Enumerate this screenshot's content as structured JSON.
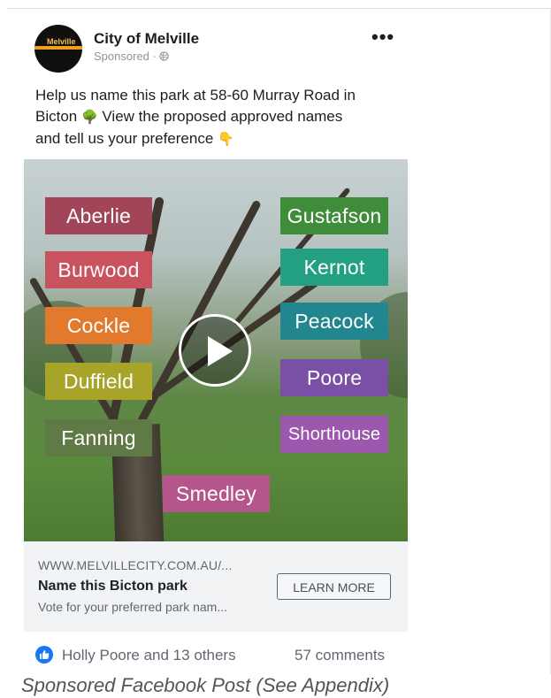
{
  "post": {
    "page_name": "City of Melville",
    "sponsored": "Sponsored · ",
    "avatar_label": "Melville",
    "more_label": "•••",
    "text_line1": "Help us name this park at 58-60 Murray Road in",
    "text_line2a": "Bicton",
    "tree_emoji": "🌳",
    "text_line2b": " View the proposed approved names",
    "text_line3": "and tell us your preference",
    "pointing_emoji": "👇",
    "globe_icon": "globe-icon"
  },
  "media": {
    "names": [
      {
        "label": "Aberlie",
        "color": "#a34558"
      },
      {
        "label": "Burwood",
        "color": "#c8535f"
      },
      {
        "label": "Cockle",
        "color": "#e27a2e"
      },
      {
        "label": "Duffield",
        "color": "#a8a42a"
      },
      {
        "label": "Fanning",
        "color": "#5f7a45"
      },
      {
        "label": "Smedley",
        "color": "#b4568b"
      },
      {
        "label": "Gustafson",
        "color": "#3f8c3b"
      },
      {
        "label": "Kernot",
        "color": "#22a081"
      },
      {
        "label": "Peacock",
        "color": "#22868f"
      },
      {
        "label": "Poore",
        "color": "#7a4fa6"
      },
      {
        "label": "Shorthouse",
        "color": "#9b58ad"
      }
    ],
    "play_icon": "play-icon"
  },
  "link": {
    "domain": "WWW.MELVILLECITY.COM.AU/...",
    "title": "Name this Bicton park",
    "description": "Vote for your preferred park nam...",
    "cta": "LEARN MORE"
  },
  "footer": {
    "reactions": "Holly Poore and 13 others",
    "comments": "57 comments",
    "like_color": "#1877f2"
  },
  "caption": "Sponsored Facebook Post (See Appendix)"
}
